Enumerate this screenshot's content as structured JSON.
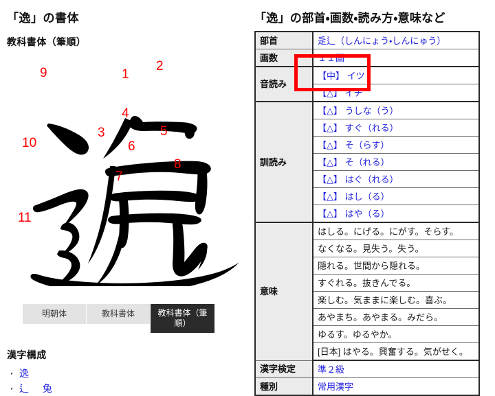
{
  "left": {
    "title": "「逸」の書体",
    "subtitle": "教科書体（筆順）",
    "kanji": "逸",
    "stroke_numbers": [
      "1",
      "2",
      "3",
      "4",
      "5",
      "6",
      "7",
      "8",
      "9",
      "10",
      "11"
    ],
    "stroke_number_color": "#ff0000",
    "ink_color": "#000000",
    "tabs": [
      {
        "label": "明朝体",
        "active": false
      },
      {
        "label": "教科書体",
        "active": false
      },
      {
        "label": "教科書体（筆順）",
        "active": true
      }
    ],
    "composition": {
      "heading": "漢字構成",
      "items": [
        "逸",
        "辶 兔"
      ]
    }
  },
  "right": {
    "title": "「逸」の部首・画数・読み方・意味など",
    "link_color": "#2121dd",
    "highlight_color": "#ff0000",
    "rows": [
      {
        "label": "部首",
        "type": "link",
        "values": [
          "辵辶（しんにょう・しんにゅう）"
        ]
      },
      {
        "label": "画数",
        "type": "link",
        "values": [
          "１１画"
        ]
      },
      {
        "label": "音読み",
        "type": "link",
        "highlighted": true,
        "values": [
          "【中】 イツ",
          "【△】 イチ"
        ]
      },
      {
        "label": "訓読み",
        "type": "link",
        "values": [
          "【△】 うしな（う）",
          "【△】 すぐ（れる）",
          "【△】 そ（らす）",
          "【△】 そ（れる）",
          "【△】 はぐ（れる）",
          "【△】 はし（る）",
          "【△】 はや（る）"
        ]
      },
      {
        "label": "意味",
        "type": "plain",
        "values": [
          "はしる。にげる。にがす。そらす。",
          "なくなる。見失う。失う。",
          "隠れる。世間から隠れる。",
          "すぐれる。抜きんでる。",
          "楽しむ。気ままに楽しむ。喜ぶ。",
          "あやまち。あやまる。みだら。",
          "ゆるす。ゆるやか。",
          "[日本] はやる。興奮する。気がせく。"
        ]
      },
      {
        "label": "漢字検定",
        "type": "link",
        "values": [
          "準２級"
        ]
      },
      {
        "label": "種別",
        "type": "link",
        "values": [
          "常用漢字"
        ]
      }
    ]
  }
}
